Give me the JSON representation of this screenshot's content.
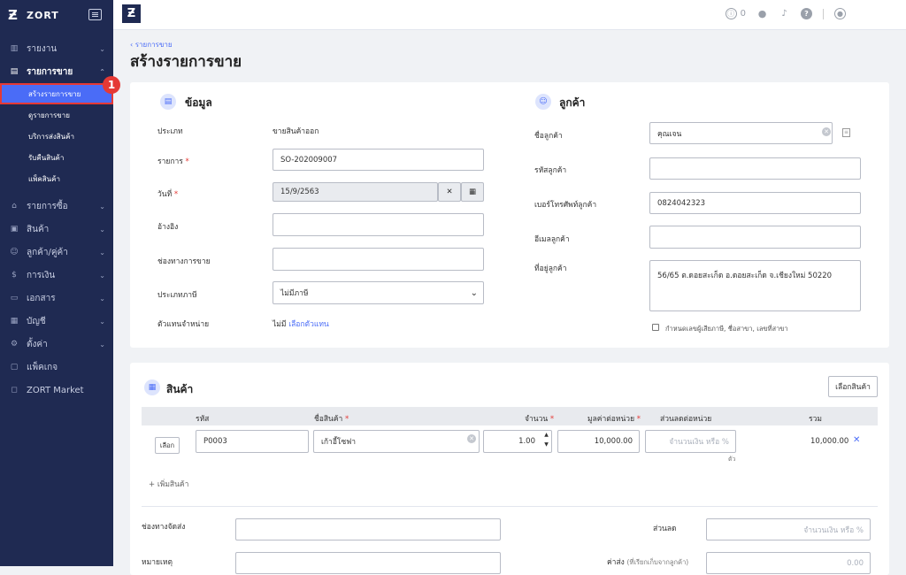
{
  "app": {
    "logo_mark": "Ƶ",
    "name": "ZORT"
  },
  "sidebar": {
    "items": [
      {
        "label": "รายงาน",
        "icon": "bar-chart-icon"
      },
      {
        "label": "รายการขาย",
        "icon": "clipboard-icon"
      },
      {
        "label": "รายการซื้อ",
        "icon": "basket-icon"
      },
      {
        "label": "สินค้า",
        "icon": "box-icon"
      },
      {
        "label": "ลูกค้า/คู่ค้า",
        "icon": "users-icon"
      },
      {
        "label": "การเงิน",
        "icon": "money-icon"
      },
      {
        "label": "เอกสาร",
        "icon": "document-icon"
      },
      {
        "label": "บัญชี",
        "icon": "ledger-icon"
      },
      {
        "label": "ตั้งค่า",
        "icon": "gear-icon"
      },
      {
        "label": "แพ็คเกจ",
        "icon": "package-icon"
      },
      {
        "label": "ZORT Market",
        "icon": "bag-icon"
      }
    ],
    "sub_items": [
      "สร้างรายการขาย",
      "ดูรายการขาย",
      "บริการส่งสินค้า",
      "รับคืนสินค้า",
      "แพ็คสินค้า"
    ],
    "callout": "1"
  },
  "topbar": {
    "logo_mark": "Ƶ",
    "notification_count": "0"
  },
  "page": {
    "breadcrumb": "‹ รายการขาย",
    "title": "สร้างรายการขาย"
  },
  "info": {
    "title": "ข้อมูล",
    "type_label": "ประเภท",
    "type_value": "ขายสินค้าออก",
    "order_label": "รายการ",
    "order_value": "SO-202009007",
    "date_label": "วันที่",
    "date_value": "15/9/2563",
    "ref_label": "อ้างอิง",
    "channel_label": "ช่องทางการขาย",
    "vat_label": "ประเภทภาษี",
    "vat_value": "ไม่มีภาษี",
    "agent_label": "ตัวแทนจำหน่าย",
    "agent_value": "ไม่มี",
    "agent_link": "เลือกตัวแทน"
  },
  "customer": {
    "title": "ลูกค้า",
    "name_label": "ชื่อลูกค้า",
    "name_value": "คุณเจน",
    "code_label": "รหัสลูกค้า",
    "phone_label": "เบอร์โทรศัพท์ลูกค้า",
    "phone_value": "0824042323",
    "email_label": "อีเมลลูกค้า",
    "address_label": "ที่อยู่ลูกค้า",
    "address_value": "56/65 ต.ดอยสะเก็ด อ.ดอยสะเก็ด จ.เชียงใหม่ 50220",
    "tax_checkbox_label": "กำหนดเลขผู้เสียภาษี, ชื่อสาขา, เลขที่สาขา"
  },
  "products": {
    "title": "สินค้า",
    "select_button": "เลือกสินค้า",
    "columns": {
      "code": "รหัส",
      "name": "ชื่อสินค้า",
      "qty": "จำนวน",
      "price": "มูลค่าต่อหน่วย",
      "discount": "ส่วนลดต่อหน่วย",
      "total": "รวม"
    },
    "required_mark": "*",
    "row": {
      "select_label": "เลือก",
      "code": "P0003",
      "name": "เก้าอี้โซฟา",
      "qty": "1.00",
      "price": "10,000.00",
      "discount_placeholder": "จำนวนเงิน หรือ %",
      "unit": "ตัว",
      "total": "10,000.00"
    },
    "add_label": "+ เพิ่มสินค้า"
  },
  "footer": {
    "shipping_channel_label": "ช่องทางจัดส่ง",
    "note_label": "หมายเหตุ",
    "discount_label": "ส่วนลด",
    "discount_placeholder": "จำนวนเงิน หรือ %",
    "shipping_fee_label": "ค่าส่ง",
    "shipping_fee_note": "(ที่เรียกเก็บจากลูกค้า)",
    "shipping_fee_value": "0.00"
  }
}
